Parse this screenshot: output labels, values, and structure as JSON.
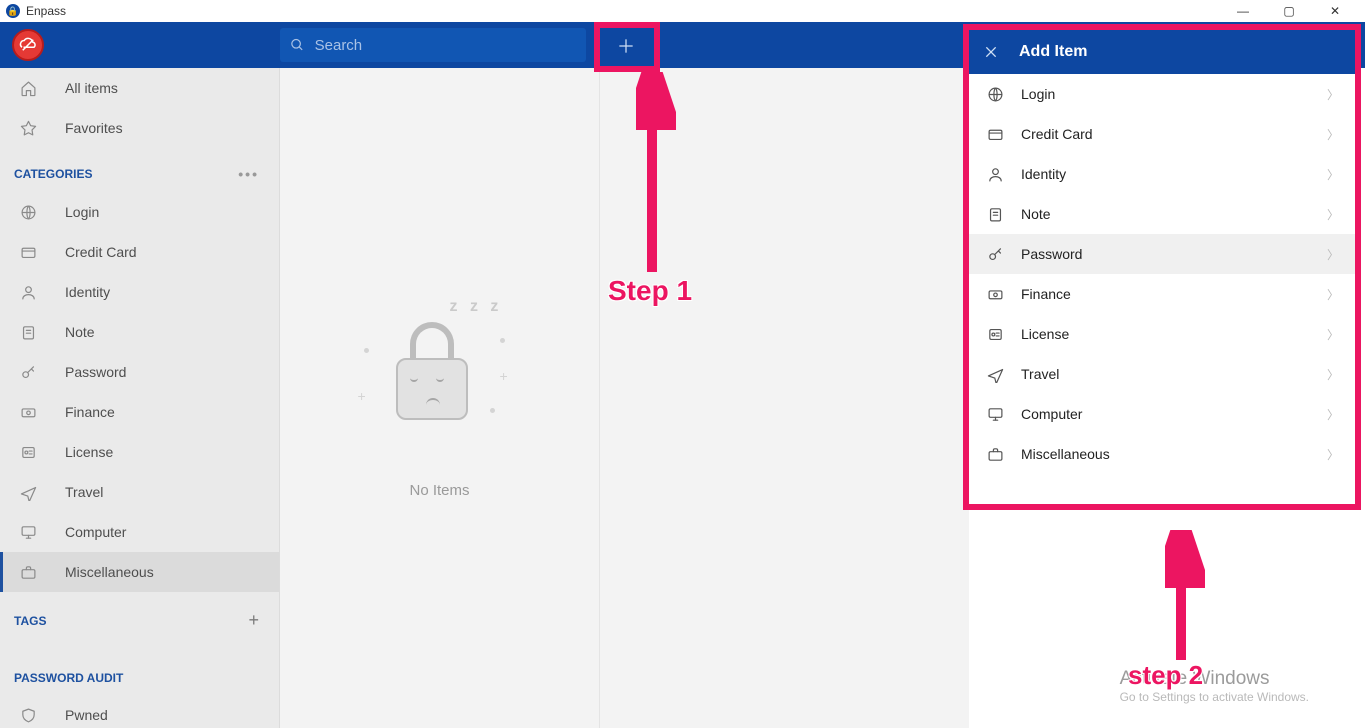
{
  "app": {
    "title": "Enpass"
  },
  "toolbar": {
    "search_placeholder": "Search"
  },
  "sidebar": {
    "nav": [
      {
        "label": "All items",
        "icon": "home"
      },
      {
        "label": "Favorites",
        "icon": "star"
      }
    ],
    "categories_header": "CATEGORIES",
    "categories": [
      {
        "label": "Login",
        "icon": "globe"
      },
      {
        "label": "Credit Card",
        "icon": "card"
      },
      {
        "label": "Identity",
        "icon": "person"
      },
      {
        "label": "Note",
        "icon": "note"
      },
      {
        "label": "Password",
        "icon": "key"
      },
      {
        "label": "Finance",
        "icon": "cash"
      },
      {
        "label": "License",
        "icon": "license"
      },
      {
        "label": "Travel",
        "icon": "plane"
      },
      {
        "label": "Computer",
        "icon": "monitor"
      },
      {
        "label": "Miscellaneous",
        "icon": "briefcase",
        "selected": true
      }
    ],
    "tags_header": "TAGS",
    "audit_header": "PASSWORD AUDIT",
    "audit": [
      {
        "label": "Pwned",
        "icon": "shield"
      }
    ]
  },
  "list": {
    "empty_label": "No Items"
  },
  "panel": {
    "title": "Add Item",
    "items": [
      {
        "label": "Login",
        "icon": "globe"
      },
      {
        "label": "Credit Card",
        "icon": "card"
      },
      {
        "label": "Identity",
        "icon": "person"
      },
      {
        "label": "Note",
        "icon": "note"
      },
      {
        "label": "Password",
        "icon": "key",
        "hover": true
      },
      {
        "label": "Finance",
        "icon": "cash"
      },
      {
        "label": "License",
        "icon": "license"
      },
      {
        "label": "Travel",
        "icon": "plane"
      },
      {
        "label": "Computer",
        "icon": "monitor"
      },
      {
        "label": "Miscellaneous",
        "icon": "briefcase"
      }
    ]
  },
  "annotations": {
    "step1": "Step 1",
    "step2": "step 2"
  },
  "watermark": {
    "line1": "Activate Windows",
    "line2": "Go to Settings to activate Windows."
  }
}
